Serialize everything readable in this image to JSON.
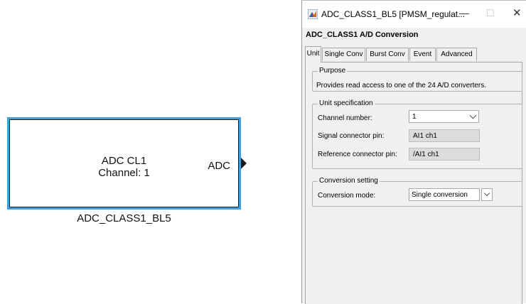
{
  "block": {
    "line1": "ADC CL1",
    "line2": "Channel: 1",
    "port_label": "ADC",
    "name": "ADC_CLASS1_BL5"
  },
  "dialog": {
    "title": "ADC_CLASS1_BL5 [PMSM_regulat...",
    "window_buttons": {
      "minimize": "—",
      "maximize": "☐",
      "close": "✕"
    },
    "header": "ADC_CLASS1  A/D Conversion",
    "tabs": [
      "Unit",
      "Single Conv",
      "Burst Conv",
      "Event",
      "Advanced"
    ],
    "active_tab": "Unit",
    "purpose": {
      "title": "Purpose",
      "text": "Provides read access to one of the 24 A/D converters."
    },
    "unit_spec": {
      "title": "Unit specification",
      "channel_label": "Channel number:",
      "channel_value": "1",
      "signal_label": "Signal connector pin:",
      "signal_value": "AI1 ch1",
      "reference_label": "Reference connector pin:",
      "reference_value": "/AI1 ch1"
    },
    "conversion": {
      "title": "Conversion setting",
      "mode_label": "Conversion mode:",
      "mode_value": "Single conversion"
    }
  },
  "colors": {
    "selection_border": "#3fa0e0",
    "dialog_bg": "#f0f0f0",
    "readonly_bg": "#dcdcdc"
  }
}
